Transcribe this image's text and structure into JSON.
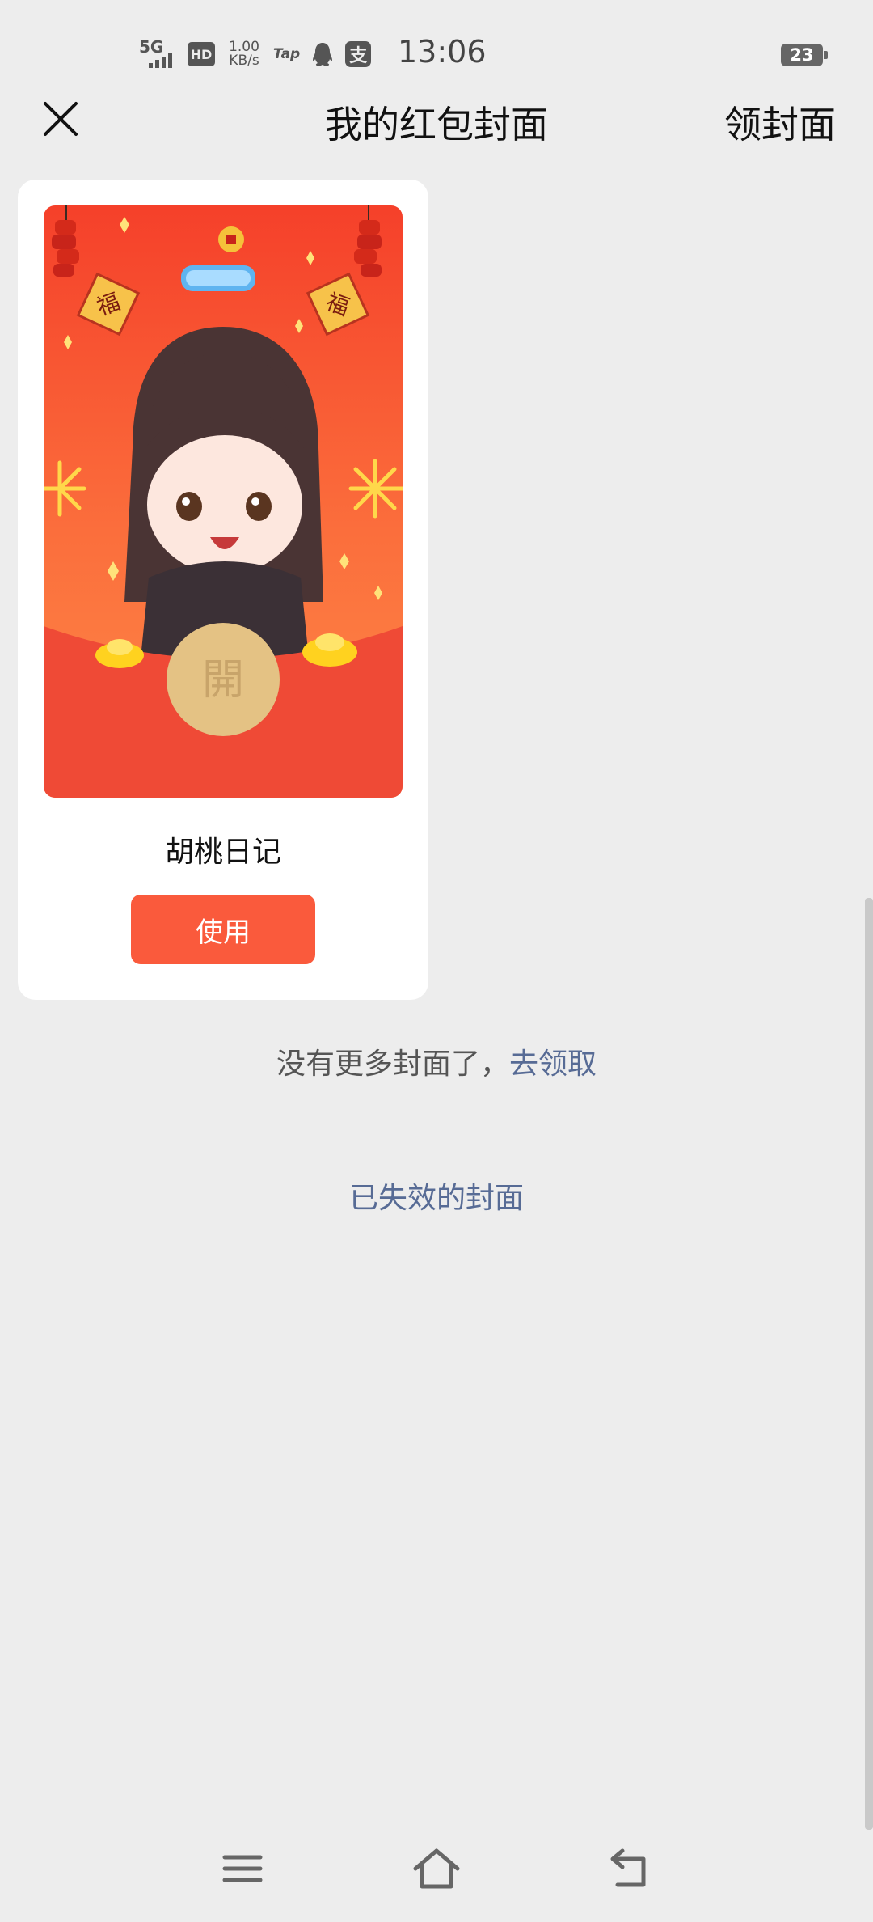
{
  "status_bar": {
    "network": "5G",
    "hd": "HD",
    "speed_value": "1.00",
    "speed_unit": "KB/s",
    "tap": "Tap",
    "pay_glyph": "支",
    "time": "13:06",
    "battery": "23"
  },
  "header": {
    "title": "我的红包封面",
    "claim_label": "领封面",
    "close_icon": "close-icon"
  },
  "cover": {
    "name": "胡桃日记",
    "use_label": "使用",
    "open_glyph": "開",
    "fu_glyph": "福"
  },
  "footer_text": {
    "no_more": "没有更多封面了，",
    "go_claim": "去领取",
    "expired": "已失效的封面"
  },
  "colors": {
    "accent": "#fa5a3c",
    "link": "#576b95",
    "background": "#ededed",
    "cover_top": "#f5402a",
    "cover_bottom": "#f25d40"
  },
  "system_nav": {
    "icons": [
      "menu-icon",
      "home-icon",
      "back-icon"
    ]
  }
}
